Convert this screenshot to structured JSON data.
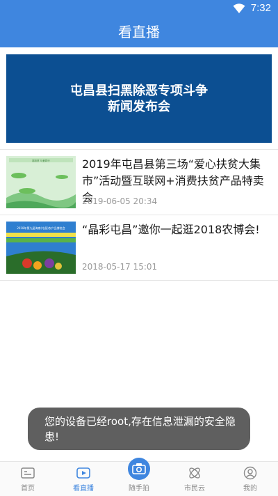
{
  "status_bar": {
    "time": "7:32",
    "icons": [
      "wifi-icon",
      "battery-icon"
    ]
  },
  "header": {
    "title": "看直播"
  },
  "banner": {
    "line1": "屯昌县扫黑除恶专项斗争",
    "line2": "新闻发布会"
  },
  "news": [
    {
      "title": "2019年屯昌县第三场“爱心扶贫大集市”活动暨互联网+消费扶贫产品特卖会",
      "time": "2019-06-05 20:34",
      "thumb_text": "振扶贫 与爱同行"
    },
    {
      "title": "“晶彩屯昌”邀你一起逛2018农博会!",
      "time": "2018-05-17 15:01",
      "thumb_text": "2018年第九届海南(屯昌)农产品博览会"
    }
  ],
  "toast": {
    "message": "您的设备已经root,存在信息泄漏的安全隐患!"
  },
  "tab_bar": {
    "items": [
      {
        "label": "首页",
        "icon": "home-icon",
        "active": false
      },
      {
        "label": "看直播",
        "icon": "live-play-icon",
        "active": true
      },
      {
        "label": "随手拍",
        "icon": "camera-icon",
        "active": false
      },
      {
        "label": "市民云",
        "icon": "citizen-cloud-icon",
        "active": false
      },
      {
        "label": "我的",
        "icon": "profile-icon",
        "active": false
      }
    ]
  },
  "colors": {
    "primary": "#3f86df",
    "banner_bg": "#0c4f92"
  }
}
